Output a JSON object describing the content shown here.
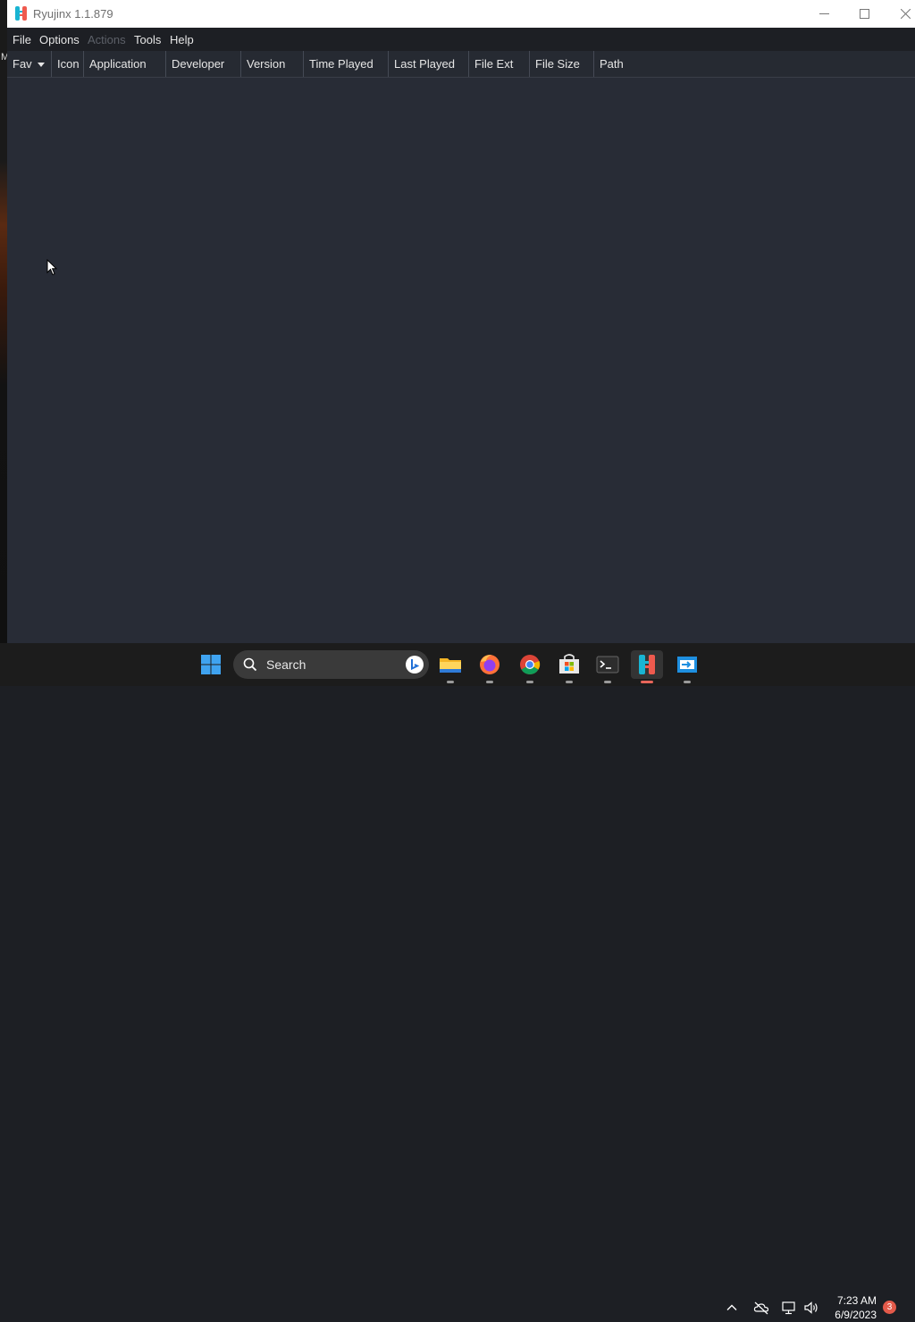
{
  "window": {
    "title": "Ryujinx 1.1.879"
  },
  "desktop": {
    "edge_text": "M"
  },
  "menu": {
    "items": [
      {
        "label": "File",
        "enabled": true
      },
      {
        "label": "Options",
        "enabled": true
      },
      {
        "label": "Actions",
        "enabled": false
      },
      {
        "label": "Tools",
        "enabled": true
      },
      {
        "label": "Help",
        "enabled": true
      }
    ]
  },
  "table": {
    "columns": [
      {
        "label": "Fav",
        "sorted": "descending"
      },
      {
        "label": "Icon"
      },
      {
        "label": "Application"
      },
      {
        "label": "Developer"
      },
      {
        "label": "Version"
      },
      {
        "label": "Time Played"
      },
      {
        "label": "Last Played"
      },
      {
        "label": "File Ext"
      },
      {
        "label": "File Size"
      },
      {
        "label": "Path"
      }
    ],
    "rows": []
  },
  "taskbar": {
    "search_placeholder": "Search",
    "apps": [
      "start-icon",
      "file-explorer-icon",
      "firefox-icon",
      "chrome-icon",
      "microsoft-store-icon",
      "terminal-icon",
      "ryujinx-icon",
      "remote-desktop-icon"
    ],
    "active_app": "ryujinx-icon",
    "clock_time": "7:23 AM",
    "clock_date": "6/9/2023",
    "notification_count": "3"
  },
  "colors": {
    "window_bg": "#282c36",
    "menubar_bg": "#1d1f24",
    "header_bg": "#262a32",
    "taskbar_bg": "#1c1c1c",
    "ryujinx_blue": "#19b4d2",
    "ryujinx_red": "#ef5a4e"
  }
}
